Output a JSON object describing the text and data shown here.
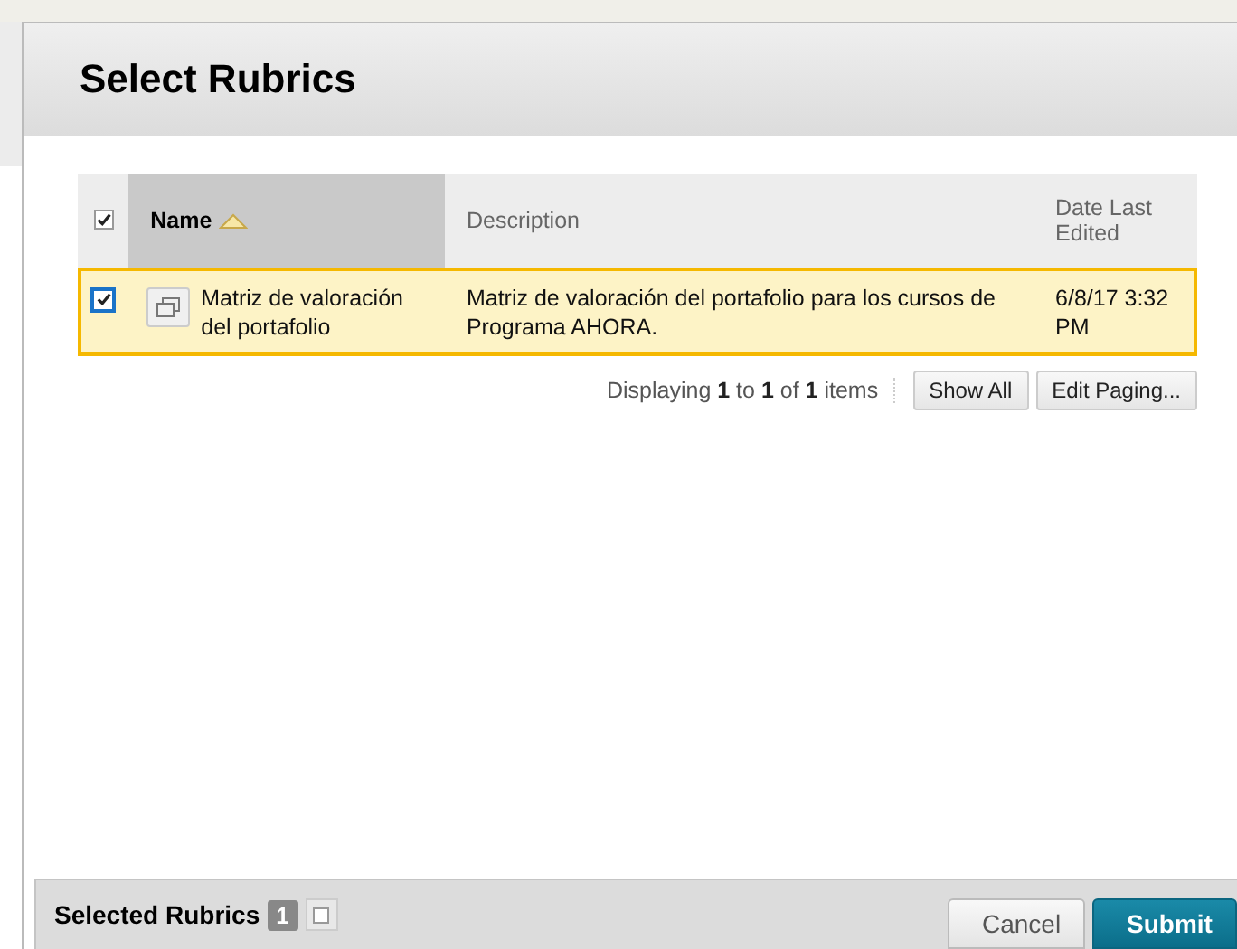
{
  "dialog": {
    "title": "Select Rubrics"
  },
  "table": {
    "select_all_checked": true,
    "columns": [
      {
        "label": "Name",
        "sorted": true
      },
      {
        "label": "Description",
        "sorted": false
      },
      {
        "label": "Date Last Edited",
        "sorted": false
      }
    ],
    "rows": [
      {
        "selected": true,
        "name": "Matriz de valoración del portafolio",
        "description": "Matriz de valoración del portafolio para los cursos de Programa AHORA.",
        "date": "6/8/17 3:32 PM"
      }
    ]
  },
  "paging": {
    "summary": "Displaying **1** to **1** of **1** items",
    "buttons": [
      "Show All",
      "Edit Paging..."
    ]
  },
  "footer": {
    "label": "Selected Rubrics",
    "count": "1",
    "buttons": [
      {
        "label": "Cancel",
        "kind": "secondary"
      },
      {
        "label": "Submit",
        "kind": "primary"
      }
    ]
  }
}
